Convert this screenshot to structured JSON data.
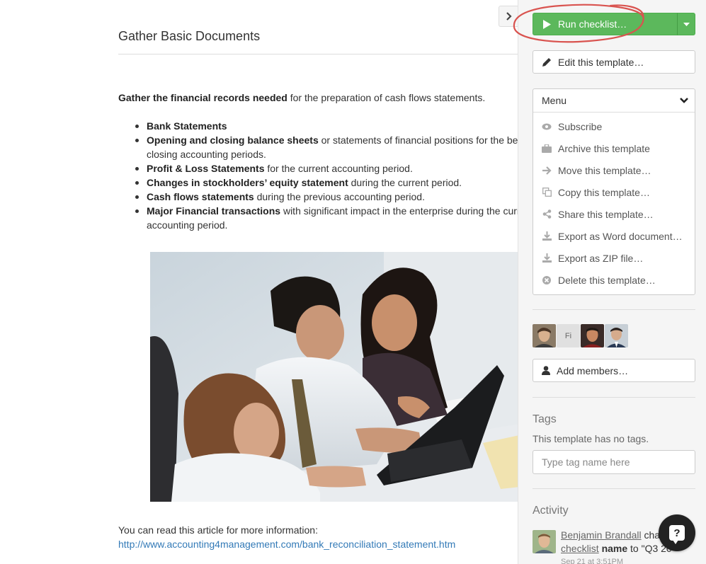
{
  "task": {
    "title": "Gather Basic Documents",
    "intro_bold": "Gather the financial records needed",
    "intro_rest": " for the preparation of cash flows statements.",
    "bullets": [
      {
        "bold": "Bank Statements",
        "rest": ""
      },
      {
        "bold": "Opening and closing balance sheets",
        "rest": " or statements of financial positions for the beginning and",
        "rest2": "closing accounting periods."
      },
      {
        "bold": "Profit & Loss Statements",
        "rest": " for the current accounting period."
      },
      {
        "bold": "Changes in stockholders’ equity statement",
        "rest": " during the current period."
      },
      {
        "bold": "Cash flows statements",
        "rest": " during the previous accounting period."
      },
      {
        "bold": "Major Financial transactions",
        "rest": " with significant impact in the enterprise during the current",
        "rest2": "accounting period."
      }
    ],
    "more_info_text": "You can read this article for more information:",
    "more_info_link": "http://www.accounting4management.com/bank_reconciliation_statement.htm"
  },
  "sidebar": {
    "run_label": "Run checklist…",
    "edit_label": "Edit this template…",
    "menu_label": "Menu",
    "menu_items": [
      {
        "label": "Subscribe",
        "icon": "eye-icon"
      },
      {
        "label": "Archive this template",
        "icon": "briefcase-icon"
      },
      {
        "label": "Move this template…",
        "icon": "arrow-right-icon"
      },
      {
        "label": "Copy this template…",
        "icon": "copy-icon"
      },
      {
        "label": "Share this template…",
        "icon": "share-icon"
      },
      {
        "label": "Export as Word document…",
        "icon": "download-icon"
      },
      {
        "label": "Export as ZIP file…",
        "icon": "download-icon"
      },
      {
        "label": "Delete this template…",
        "icon": "remove-circle-icon"
      }
    ],
    "members": [
      {
        "type": "photo",
        "initials": ""
      },
      {
        "type": "initials",
        "initials": "Fi"
      },
      {
        "type": "photo",
        "initials": ""
      },
      {
        "type": "photo",
        "initials": ""
      }
    ],
    "add_members_label": "Add members…",
    "tags_title": "Tags",
    "tags_empty": "This template has no tags.",
    "tag_placeholder": "Type tag name here",
    "activity_title": "Activity",
    "activity": {
      "user": "Benjamin Brandall",
      "verb": " cha",
      "object_link": "checklist",
      "field": "name",
      "to_text": " to \"Q3 20",
      "time": "Sep 21 at 3:51PM"
    }
  },
  "colors": {
    "run_button": "#5cb85c",
    "annotation": "#d9534f",
    "link": "#337ab7"
  }
}
